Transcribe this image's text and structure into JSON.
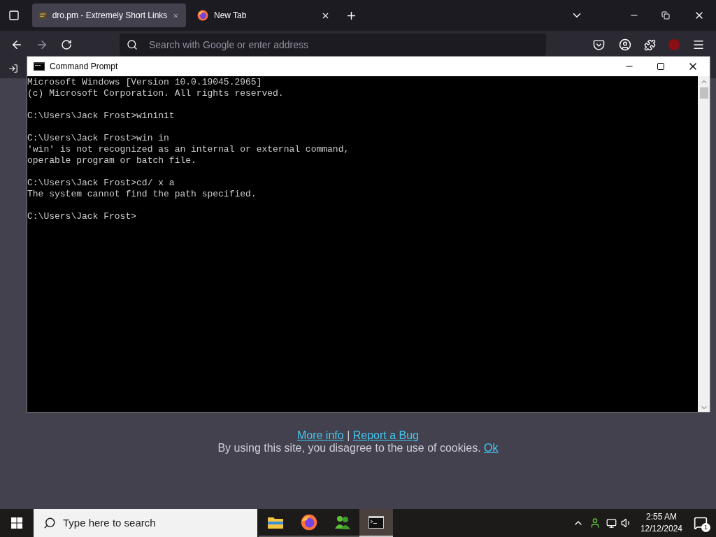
{
  "browser": {
    "tabs": [
      {
        "title": "dro.pm - Extremely Short Links",
        "kind": "site",
        "selected": true
      },
      {
        "title": "New Tab",
        "kind": "firefox",
        "selected": false
      }
    ],
    "address": {
      "placeholder": "Search with Google or enter address"
    },
    "cookie_notice": {
      "links": [
        "More info",
        "Report a Bug"
      ],
      "separator": "|",
      "text": "By using this site, you disagree to the use of cookies.",
      "ok": "Ok"
    }
  },
  "console": {
    "title": "Command Prompt",
    "blocks": [
      [
        "Microsoft Windows [Version 10.0.19045.2965]",
        "(c) Microsoft Corporation. All rights reserved."
      ],
      [
        "C:\\Users\\Jack Frost>wininit"
      ],
      [
        "C:\\Users\\Jack Frost>win in",
        "'win' is not recognized as an internal or external command,",
        "operable program or batch file."
      ],
      [
        "C:\\Users\\Jack Frost>cd/ x a",
        "The system cannot find the path specified."
      ],
      [
        "C:\\Users\\Jack Frost>"
      ]
    ]
  },
  "taskbar": {
    "search": {
      "placeholder": "Type here to search"
    },
    "apps": [
      {
        "kind": "folder",
        "selected": false
      },
      {
        "kind": "firefox",
        "selected": false
      },
      {
        "kind": "people",
        "selected": false
      },
      {
        "kind": "console",
        "selected": true
      }
    ],
    "time": "2:55 AM",
    "date": "12/12/2024",
    "notifications": "1"
  }
}
